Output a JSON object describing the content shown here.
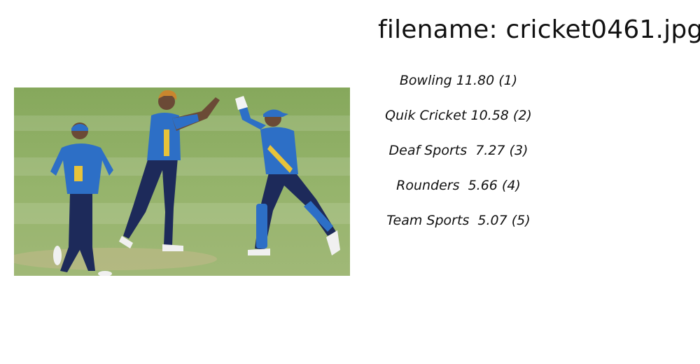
{
  "header": {
    "filename_label": "filename: cricket0461.jpg"
  },
  "photo": {
    "subject": "cricket-players-celebrating-image"
  },
  "predictions": [
    {
      "text": "Bowling 11.80 (1)"
    },
    {
      "text": "Quik Cricket 10.58 (2)"
    },
    {
      "text": "Deaf Sports  7.27 (3)"
    },
    {
      "text": "Rounders  5.66 (4)"
    },
    {
      "text": "Team Sports  5.07 (5)"
    }
  ],
  "colors": {
    "jersey_blue": "#2d6fc6",
    "trouser_navy": "#1d2a5a",
    "grass_green": "#8fae63",
    "jersey_yellow": "#e8c33a"
  }
}
